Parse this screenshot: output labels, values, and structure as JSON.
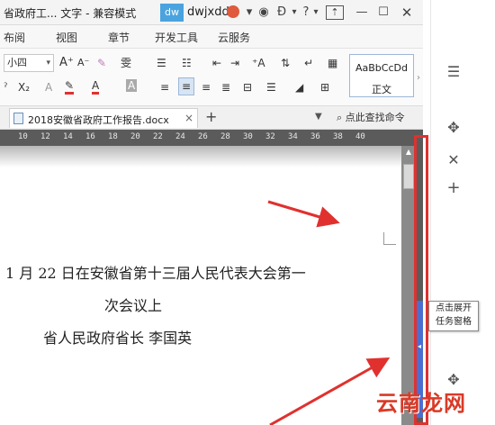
{
  "titlebar": {
    "title": "省政府工... 文字 - 兼容模式",
    "badge": "dw",
    "user": "dwjxdd",
    "help": "?"
  },
  "menu": {
    "items": [
      "布阅",
      "视图",
      "章节",
      "开发工具",
      "云服务"
    ]
  },
  "toolbar": {
    "font_size": "小四",
    "style_sample": "AaBbCcDd",
    "style_name": "正文"
  },
  "tabbar": {
    "doc_tab": "2018安徽省政府工作报告.docx",
    "search_label": "点此查找命令"
  },
  "ruler": {
    "ticks": [
      "10",
      "12",
      "14",
      "16",
      "18",
      "20",
      "22",
      "24",
      "26",
      "28",
      "30",
      "32",
      "34",
      "36",
      "38",
      "40"
    ]
  },
  "document": {
    "lines": [
      "1 月 22 日在安徽省第十三届人民代表大会第一",
      "次会议上",
      "省人民政府省长  李国英"
    ]
  },
  "tooltip": {
    "line1": "点击展开",
    "line2": "任务窗格"
  },
  "watermark": "云南龙网",
  "colors": {
    "highlight_red": "#e0312f",
    "accent_blue": "#4a6fd0",
    "badge_blue": "#4aa3df"
  }
}
